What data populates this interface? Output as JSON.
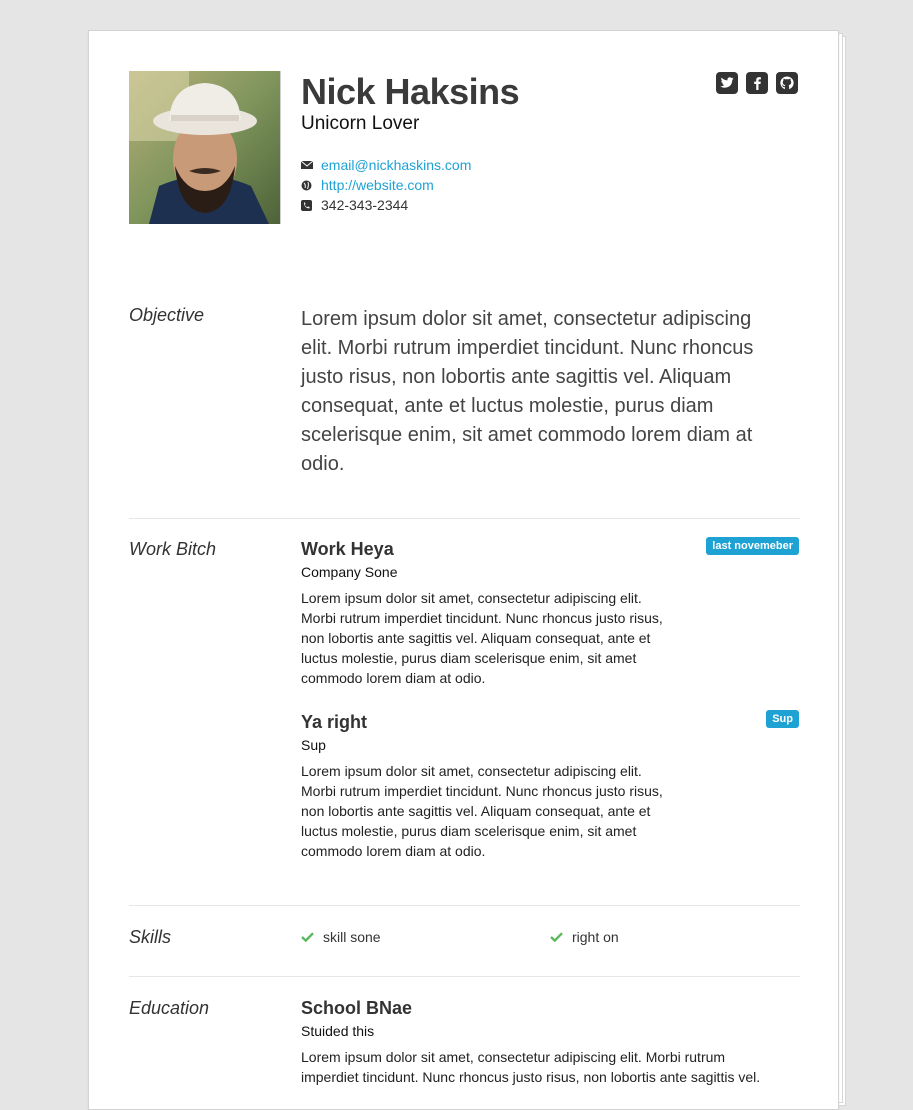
{
  "header": {
    "name": "Nick Haksins",
    "tagline": "Unicorn Lover",
    "contacts": [
      {
        "icon": "envelope-icon",
        "text": "email@nickhaskins.com",
        "link": true
      },
      {
        "icon": "globe-icon",
        "text": "http://website.com",
        "link": true
      },
      {
        "icon": "phone-icon",
        "text": "342-343-2344",
        "link": false
      }
    ],
    "social": [
      "twitter-icon",
      "facebook-icon",
      "github-icon"
    ]
  },
  "objective": {
    "title": "Objective",
    "text": "Lorem ipsum dolor sit amet, consectetur adipiscing elit. Morbi rutrum imperdiet tincidunt. Nunc rhoncus justo risus, non lobortis ante sagittis vel. Aliquam consequat, ante et luctus molestie, purus diam scelerisque enim, sit amet commodo lorem diam at odio."
  },
  "work": {
    "title": "Work Bitch",
    "jobs": [
      {
        "title": "Work Heya",
        "company": "Company Sone",
        "badge": "last novemeber",
        "description": "Lorem ipsum dolor sit amet, consectetur adipiscing elit. Morbi rutrum imperdiet tincidunt. Nunc rhoncus justo risus, non lobortis ante sagittis vel. Aliquam consequat, ante et luctus molestie, purus diam scelerisque enim, sit amet commodo lorem diam at odio."
      },
      {
        "title": "Ya right",
        "company": "Sup",
        "badge": "Sup",
        "description": "Lorem ipsum dolor sit amet, consectetur adipiscing elit. Morbi rutrum imperdiet tincidunt. Nunc rhoncus justo risus, non lobortis ante sagittis vel. Aliquam consequat, ante et luctus molestie, purus diam scelerisque enim, sit amet commodo lorem diam at odio."
      }
    ]
  },
  "skills": {
    "title": "Skills",
    "items": [
      "skill sone",
      "right on"
    ]
  },
  "education": {
    "title": "Education",
    "school": "School BNae",
    "studied": "Stuided this",
    "description": "Lorem ipsum dolor sit amet, consectetur adipiscing elit. Morbi rutrum imperdiet tincidunt. Nunc rhoncus justo risus, non lobortis ante sagittis vel."
  },
  "colors": {
    "accent": "#1ea2d4",
    "check": "#5cb85c",
    "background": "#e5e5e5"
  }
}
